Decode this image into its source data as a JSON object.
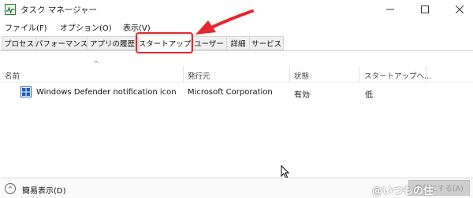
{
  "window": {
    "title": "タスク マネージャー"
  },
  "menu": [
    "ファイル(F)",
    "オプション(O)",
    "表示(V)"
  ],
  "tabs": [
    "プロセス",
    "パフォーマンス",
    "アプリの履歴",
    "スタートアップ",
    "ユーザー",
    "詳細",
    "サービス"
  ],
  "active_tab": "スタートアップ",
  "columns": {
    "name": "名前",
    "publisher": "発行元",
    "status": "状態",
    "impact": "スタートアップへ..."
  },
  "rows": [
    {
      "name": "Windows Defender notification icon",
      "publisher": "Microsoft Corporation",
      "status": "有効",
      "impact": "低",
      "icon": "windows-defender-shield-icon"
    }
  ],
  "footer": {
    "collapse_label": "簡易表示(D)",
    "disable_button": "無効にする(A)"
  },
  "watermark": "@いつもの住",
  "colors": {
    "highlight": "#e5262a",
    "arrow": "#e5262a"
  }
}
